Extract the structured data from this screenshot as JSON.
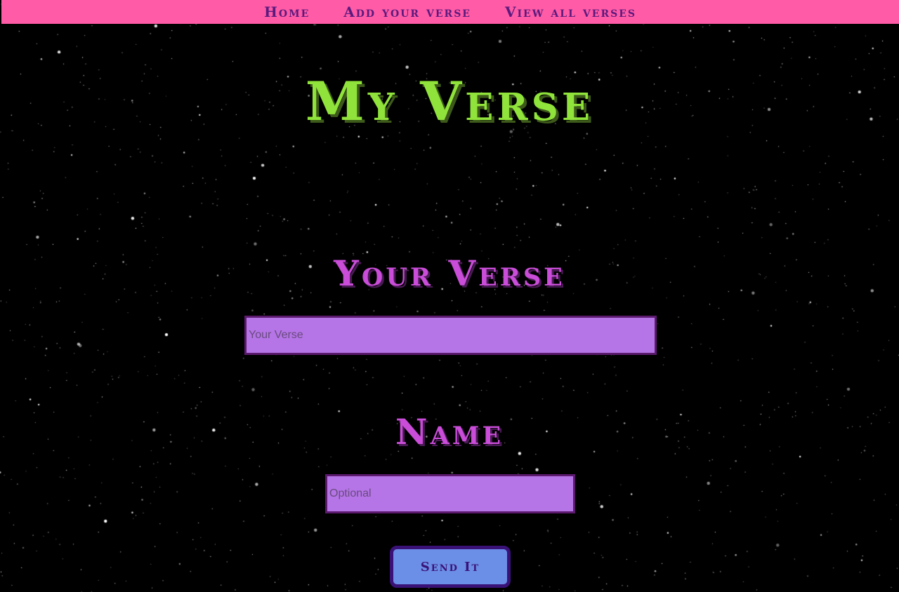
{
  "nav": {
    "items": [
      {
        "label": "Home"
      },
      {
        "label": "Add your verse"
      },
      {
        "label": "View all verses"
      }
    ]
  },
  "page": {
    "title": "My Verse"
  },
  "form": {
    "verse": {
      "heading": "Your Verse",
      "placeholder": "Your Verse",
      "value": ""
    },
    "name": {
      "heading": "Name",
      "placeholder": "Optional",
      "value": ""
    },
    "submit_label": "Send It"
  },
  "colors": {
    "nav_background": "#ff5ba6",
    "nav_text": "#5a1a7e",
    "title": "#8fe33a",
    "heading": "#c94dd8",
    "input_background": "#b575e6",
    "input_border": "#5c1a6e",
    "button_background": "#6b8ee6",
    "button_border": "#3a1277",
    "page_background": "#000000"
  }
}
